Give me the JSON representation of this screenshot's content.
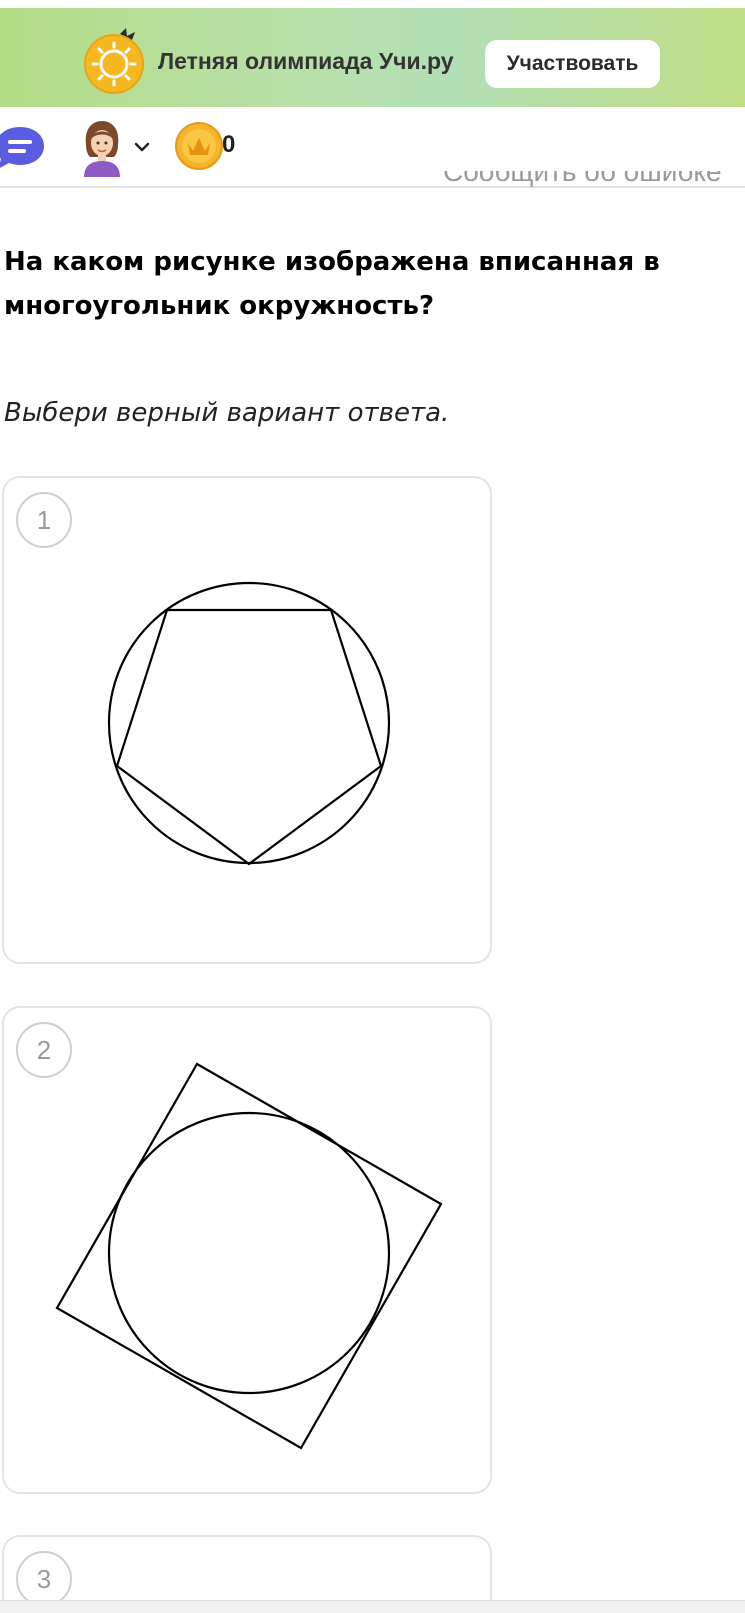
{
  "banner": {
    "title": "Летняя олимпиада Учи.ру",
    "button_label": "Участвовать",
    "background_color": "#b9e0a9",
    "icon": "sun-icon"
  },
  "topbar": {
    "chat_icon": "chat-bubble-icon",
    "chat_color": "#5b5ce0",
    "avatar_icon": "girl-avatar",
    "chevron_icon": "chevron-down-icon",
    "coin_icon": "crown-coin-icon",
    "coin_color": "#f5b52a",
    "coin_count": "0"
  },
  "report_link": "Сообщить об ошибке",
  "question": {
    "text": "На каком рисунке изображена вписанная в многоугольник окружность?",
    "instruction": "Выбери верный вариант ответа."
  },
  "options": [
    {
      "number": "1",
      "figure": "pentagon-inscribed-in-circle"
    },
    {
      "number": "2",
      "figure": "circle-inscribed-in-square"
    },
    {
      "number": "3",
      "figure": ""
    }
  ]
}
